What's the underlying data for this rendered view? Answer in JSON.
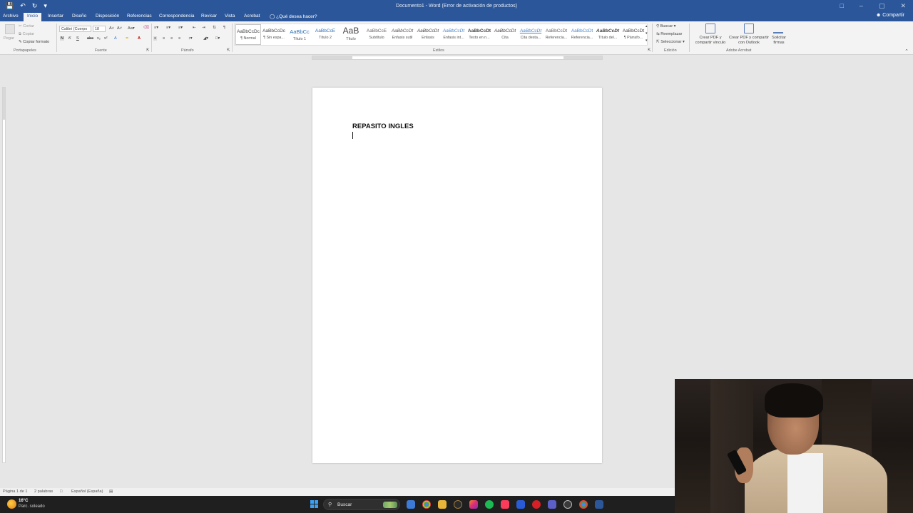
{
  "window": {
    "title": "Documento1 - Word (Error de activación de productos)",
    "share_label": "Compartir"
  },
  "tabs": [
    {
      "label": "Archivo",
      "active": false
    },
    {
      "label": "Inicio",
      "active": true
    },
    {
      "label": "Insertar",
      "active": false
    },
    {
      "label": "Diseño",
      "active": false
    },
    {
      "label": "Disposición",
      "active": false
    },
    {
      "label": "Referencias",
      "active": false
    },
    {
      "label": "Correspondencia",
      "active": false
    },
    {
      "label": "Revisar",
      "active": false
    },
    {
      "label": "Vista",
      "active": false
    },
    {
      "label": "Acrobat",
      "active": false
    }
  ],
  "tell_me": "¿Qué desea hacer?",
  "ribbon": {
    "clipboard": {
      "paste": "Pegar",
      "cut": "Cortar",
      "copy": "Copiar",
      "format_painter": "Copiar formato",
      "group": "Portapapeles"
    },
    "font": {
      "font_name": "Calibri (Cuerpo",
      "font_size": "18",
      "group": "Fuente"
    },
    "paragraph": {
      "group": "Párrafo"
    },
    "styles": {
      "group": "Estilos",
      "items": [
        {
          "preview": "AaBbCcDc",
          "name": "¶ Normal"
        },
        {
          "preview": "AaBbCcDc",
          "name": "¶ Sin espa..."
        },
        {
          "preview": "AaBbCc",
          "name": "Título 1"
        },
        {
          "preview": "AaBbCcE",
          "name": "Título 2"
        },
        {
          "preview": "AaB",
          "name": "Título"
        },
        {
          "preview": "AaBbCcE",
          "name": "Subtítulo"
        },
        {
          "preview": "AaBbCcDt",
          "name": "Énfasis sutil"
        },
        {
          "preview": "AaBbCcDt",
          "name": "Énfasis"
        },
        {
          "preview": "AaBbCcDt",
          "name": "Énfasis int..."
        },
        {
          "preview": "AaBbCcDt",
          "name": "Texto en n..."
        },
        {
          "preview": "AaBbCcDt",
          "name": "Cita"
        },
        {
          "preview": "AaBbCcDt",
          "name": "Cita desta..."
        },
        {
          "preview": "AaBbCcDt",
          "name": "Referencia..."
        },
        {
          "preview": "AaBbCcDt",
          "name": "Referencia..."
        },
        {
          "preview": "AaBbCcDt",
          "name": "Título del..."
        },
        {
          "preview": "AaBbCcDt",
          "name": "¶ Párrafo..."
        }
      ]
    },
    "editing": {
      "find": "Buscar",
      "replace": "Reemplazar",
      "select": "Seleccionar",
      "group": "Edición"
    },
    "acrobat": {
      "create_pdf_link": "Crear PDF y compartir vínculo",
      "create_pdf_outlook": "Crear PDF y compartir con Outlook",
      "request_signatures": "Solicitar firmas",
      "group": "Adobe Acrobat"
    }
  },
  "document": {
    "body_text": "REPASITO INGLES"
  },
  "status": {
    "page": "Página 1 de 1",
    "words": "2 palabras",
    "language": "Español (España)"
  },
  "taskbar": {
    "temperature": "16°C",
    "weather": "Parc. soleado",
    "search": "Buscar"
  },
  "colors": {
    "accent": "#2b579a",
    "taskbar": "#1f1f1f"
  }
}
